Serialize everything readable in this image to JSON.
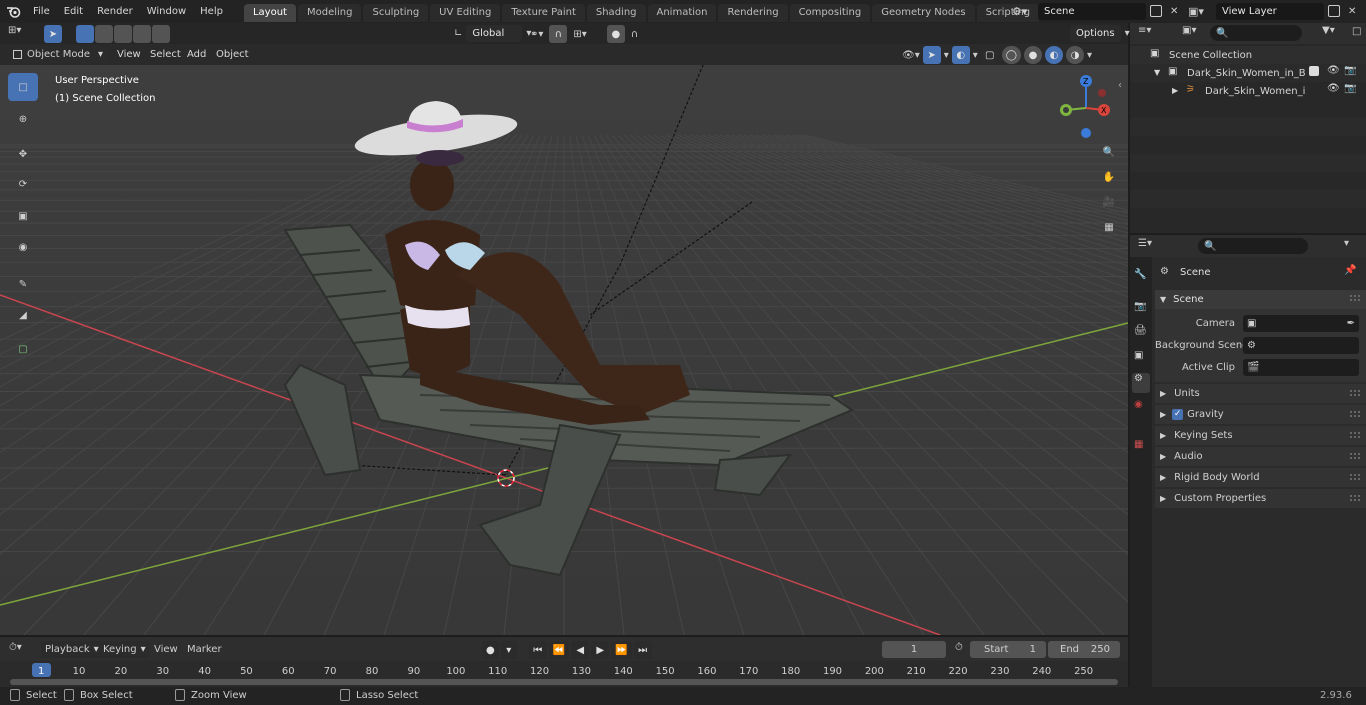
{
  "topbar": {
    "menus": [
      "File",
      "Edit",
      "Render",
      "Window",
      "Help"
    ],
    "workspaces": [
      "Layout",
      "Modeling",
      "Sculpting",
      "UV Editing",
      "Texture Paint",
      "Shading",
      "Animation",
      "Rendering",
      "Compositing",
      "Geometry Nodes",
      "Scripting"
    ],
    "active_workspace": "Layout",
    "add_tab": "+",
    "scene_name": "Scene",
    "view_layer": "View Layer"
  },
  "viewport_header": {
    "mode": "Object Mode",
    "menus": [
      "View",
      "Select",
      "Add",
      "Object"
    ],
    "transform_orientation": "Global",
    "options": "Options"
  },
  "viewport": {
    "perspective_label": "User Perspective",
    "collection_label": "(1) Scene Collection",
    "colors": {
      "bg": "#3b3b3b",
      "x_axis": "#c8454f",
      "y_axis": "#7fa83a",
      "accent": "#4772b3"
    }
  },
  "outliner": {
    "root": "Scene Collection",
    "items": [
      {
        "label": "Dark_Skin_Women_in_Bikini_"
      },
      {
        "label": "Dark_Skin_Women_in_Bi"
      }
    ]
  },
  "properties": {
    "header_label": "Scene",
    "panel_title": "Scene",
    "fields": [
      {
        "label": "Camera",
        "value": ""
      },
      {
        "label": "Background Scene",
        "value": ""
      },
      {
        "label": "Active Clip",
        "value": ""
      }
    ],
    "sections": [
      "Units",
      "Gravity",
      "Keying Sets",
      "Audio",
      "Rigid Body World",
      "Custom Properties"
    ],
    "gravity_enabled": true
  },
  "timeline": {
    "menus": [
      "Playback",
      "Keying",
      "View",
      "Marker"
    ],
    "current_frame": "1",
    "start_label": "Start",
    "start_value": "1",
    "end_label": "End",
    "end_value": "250",
    "ticks": [
      "1",
      "10",
      "20",
      "30",
      "40",
      "50",
      "60",
      "70",
      "80",
      "90",
      "100",
      "110",
      "120",
      "130",
      "140",
      "150",
      "160",
      "170",
      "180",
      "190",
      "200",
      "210",
      "220",
      "230",
      "240",
      "250"
    ]
  },
  "statusbar": {
    "items": [
      "Select",
      "Box Select",
      "Zoom View",
      "Lasso Select"
    ],
    "version": "2.93.6"
  }
}
